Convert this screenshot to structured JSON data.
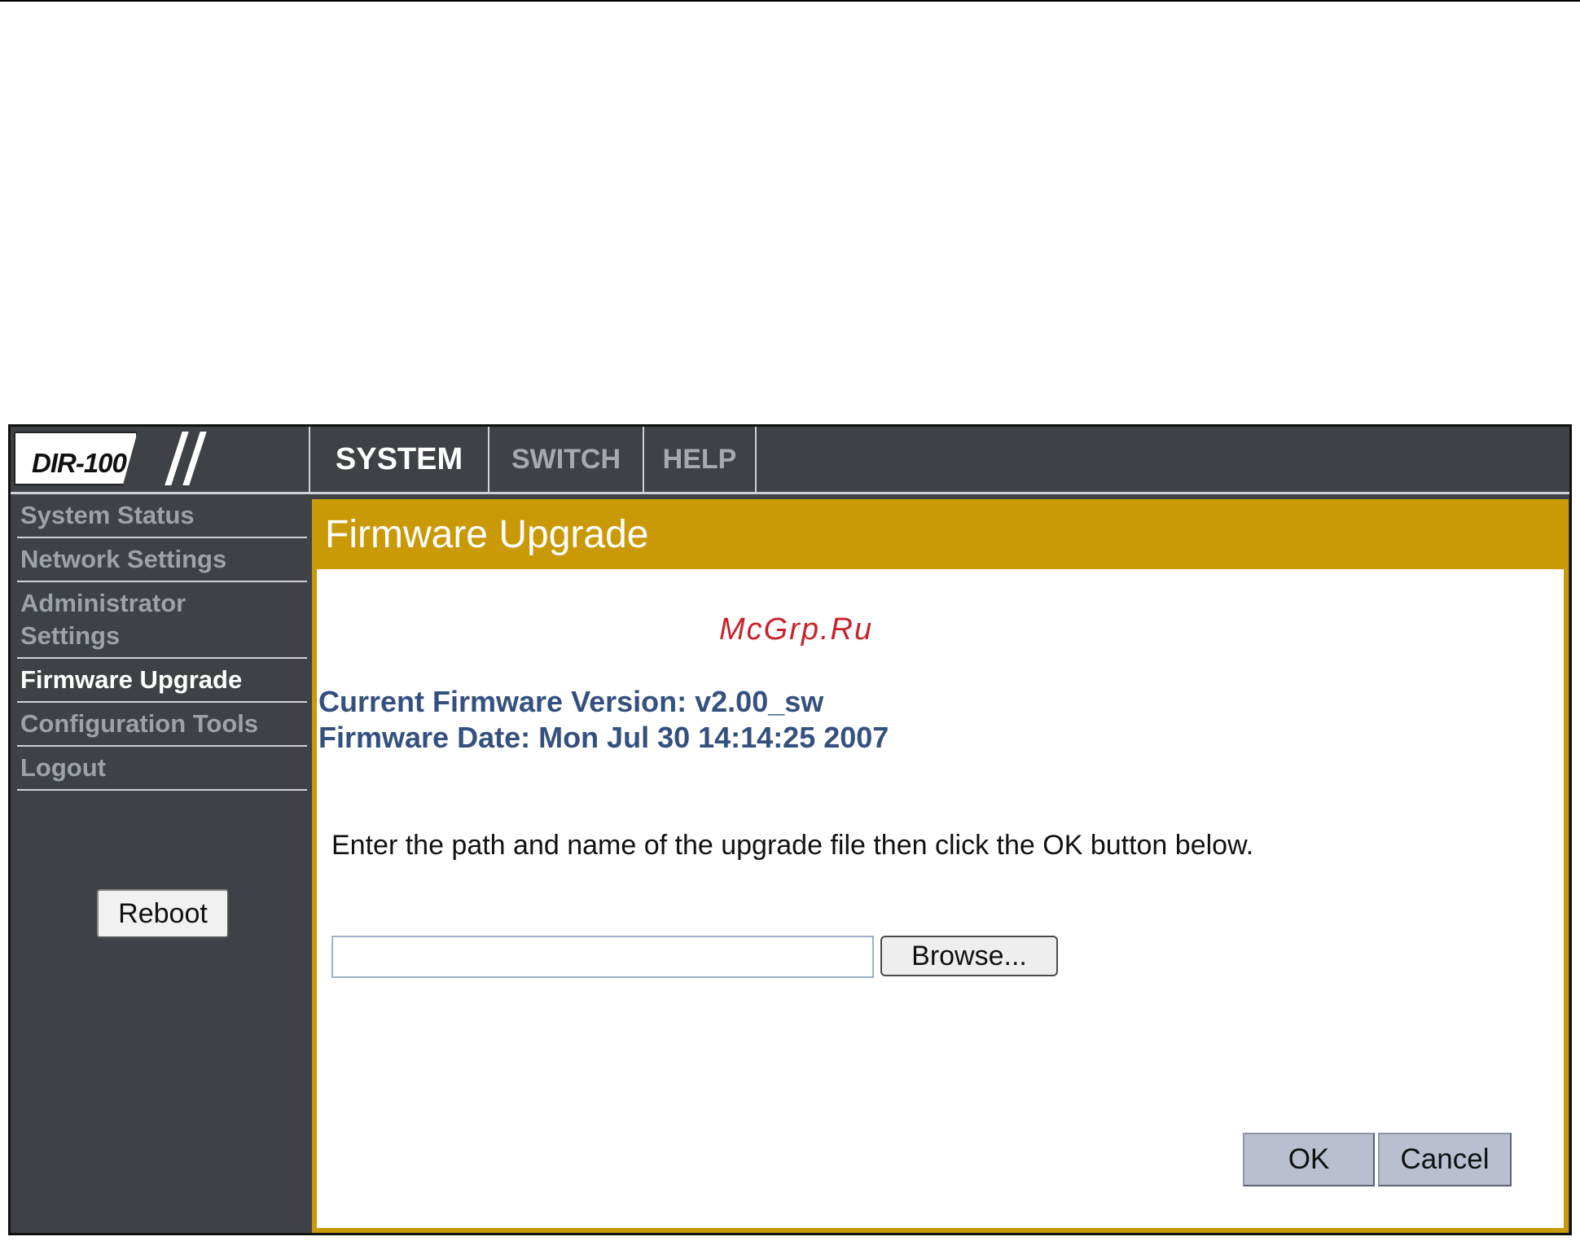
{
  "header": {
    "logo": "DIR-100",
    "tabs": [
      {
        "label": "SYSTEM",
        "active": true
      },
      {
        "label": "SWITCH",
        "active": false
      },
      {
        "label": "HELP",
        "active": false
      }
    ]
  },
  "sidebar": {
    "items": [
      {
        "label": "System Status",
        "active": false
      },
      {
        "label": "Network Settings",
        "active": false
      },
      {
        "label": "Administrator Settings",
        "active": false
      },
      {
        "label": "Firmware Upgrade",
        "active": true
      },
      {
        "label": "Configuration Tools",
        "active": false
      },
      {
        "label": "Logout",
        "active": false
      }
    ],
    "reboot_label": "Reboot"
  },
  "main": {
    "title": "Firmware Upgrade",
    "watermark": "McGrp.Ru",
    "current_version": "Current Firmware Version: v2.00_sw",
    "firmware_date": "Firmware Date: Mon Jul 30 14:14:25 2007",
    "instruction": "Enter the path and name of the upgrade file then click the OK button below.",
    "file_path_value": "",
    "browse_label": "Browse...",
    "ok_label": "OK",
    "cancel_label": "Cancel"
  },
  "colors": {
    "accent": "#c99a06",
    "sidebar_bg": "#3e4246",
    "info_text": "#34507e",
    "watermark": "#c8232c"
  }
}
